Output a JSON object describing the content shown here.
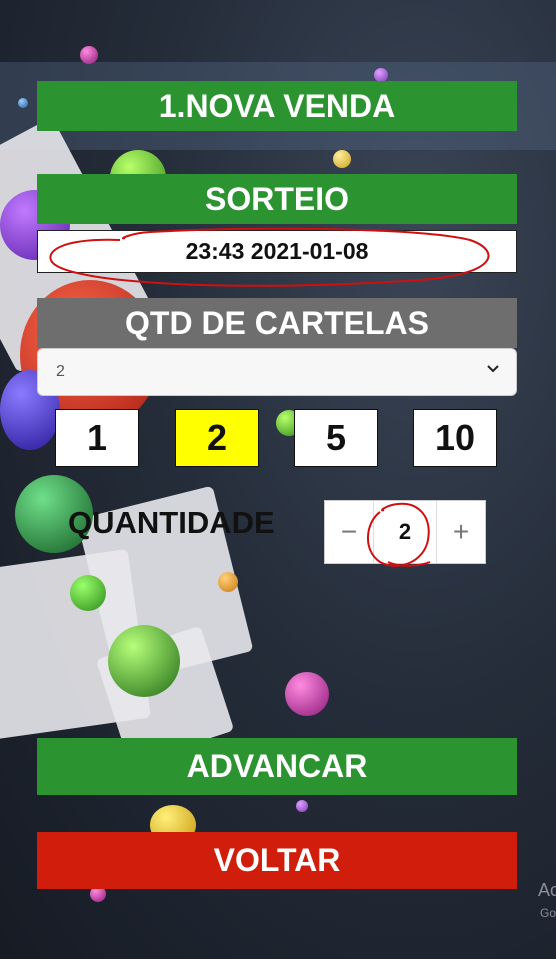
{
  "header": {
    "title": "1.NOVA VENDA"
  },
  "draw": {
    "label": "SORTEIO",
    "value": "23:43 2021-01-08"
  },
  "cards": {
    "label": "QTD DE CARTELAS",
    "selected": "2",
    "quick_options": [
      "1",
      "2",
      "5",
      "10"
    ],
    "active_option": "2"
  },
  "quantity": {
    "label": "QUANTIDADE",
    "minus": "−",
    "value": "2",
    "plus": "+"
  },
  "actions": {
    "advance": "ADVANCAR",
    "back": "VOLTAR"
  },
  "watermark": {
    "line1": "Ac",
    "line2": "Go"
  },
  "colors": {
    "green": "#2b9330",
    "gray": "#6e6e6e",
    "red": "#d11e0c",
    "highlight": "#ffff00",
    "annotation": "#d01010"
  }
}
